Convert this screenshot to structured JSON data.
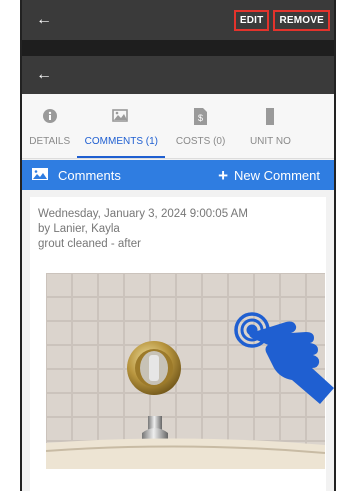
{
  "header": {
    "back_icon": "arrow-left-icon",
    "edit_label": "EDIT",
    "remove_label": "REMOVE",
    "accent_color": "#e3332c"
  },
  "subheader": {
    "back_icon": "arrow-left-icon"
  },
  "tabs": [
    {
      "icon": "info-circle-icon",
      "label": "DETAILS",
      "active": false
    },
    {
      "icon": "image-icon",
      "label": "COMMENTS (1)",
      "active": true
    },
    {
      "icon": "document-dollar-icon",
      "label": "COSTS (0)",
      "active": false
    },
    {
      "icon": "document-icon",
      "label": "UNIT NO",
      "active": false
    }
  ],
  "comments_bar": {
    "icon": "image-icon",
    "title": "Comments",
    "new_label": "New Comment",
    "color": "#2f7de1"
  },
  "comment": {
    "timestamp": "Wednesday, January 3, 2024 9:00:05 AM",
    "author": "by Lanier, Kayla",
    "text": "grout cleaned - after",
    "photo_alt": "shower tile wall with faucet handle and spout"
  },
  "overlay": {
    "icon": "tap-hand-icon"
  }
}
